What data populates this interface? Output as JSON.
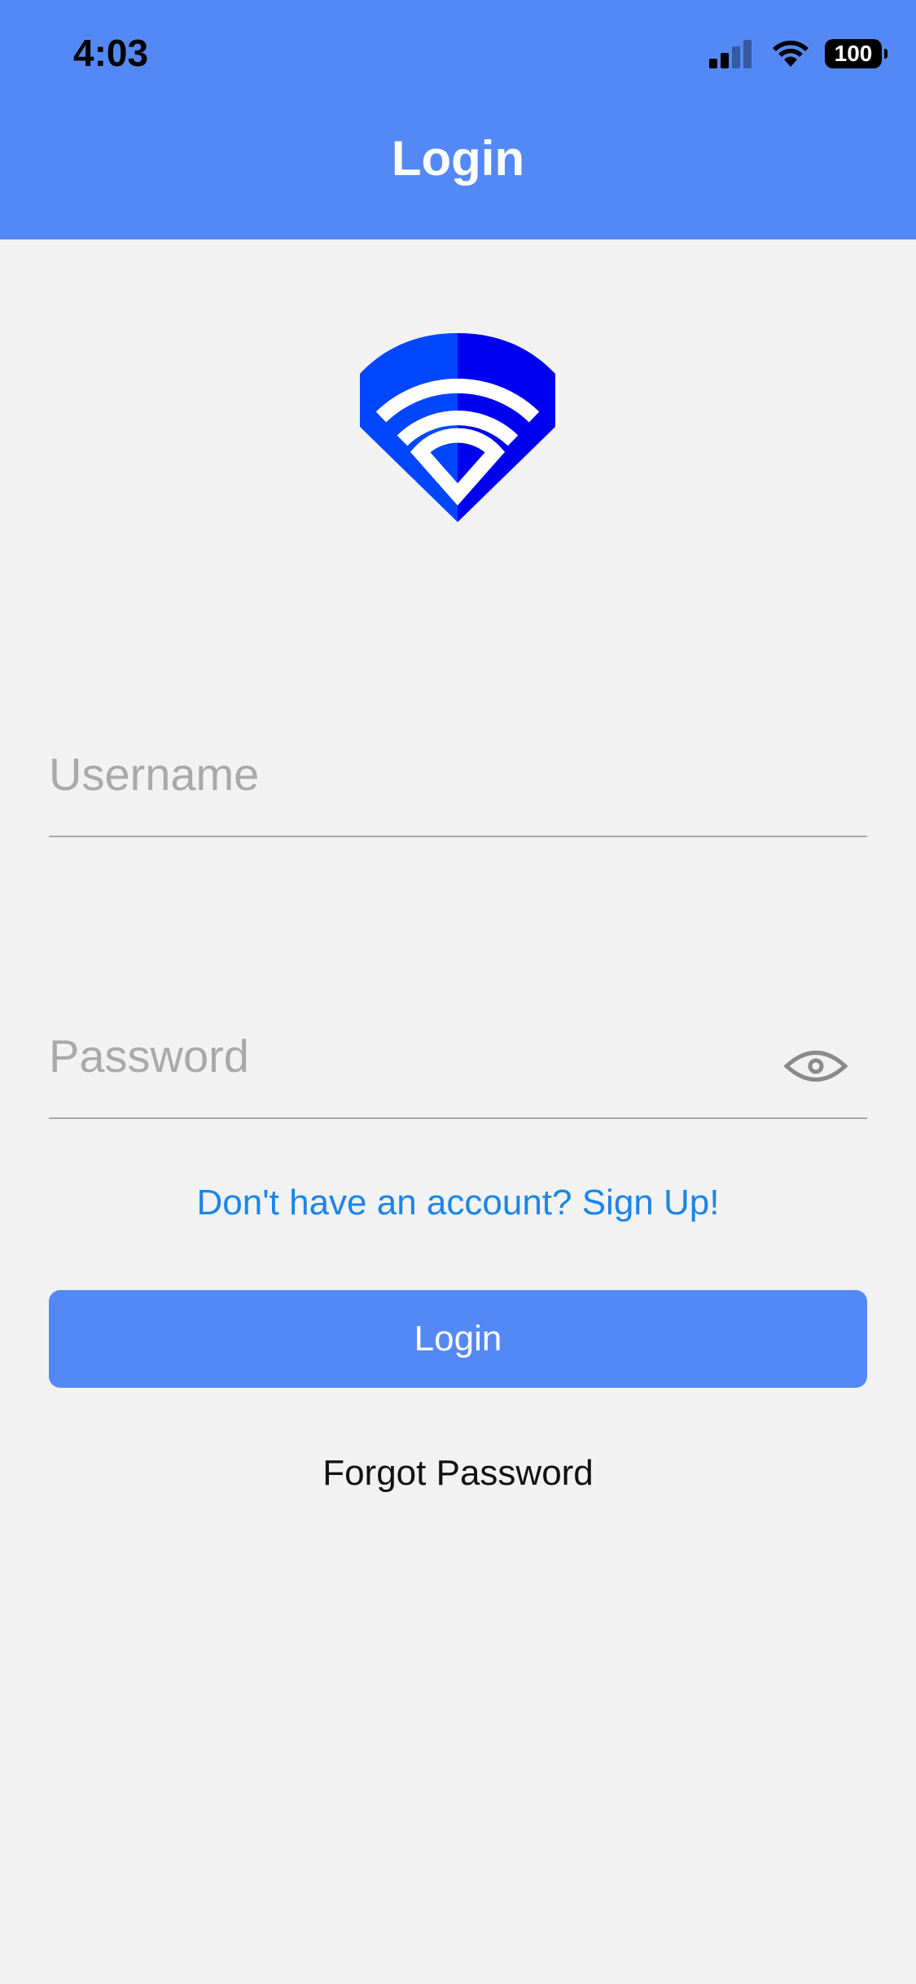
{
  "status_bar": {
    "time": "4:03",
    "battery": "100",
    "icons": [
      "signal-icon",
      "wifi-icon",
      "battery-icon"
    ]
  },
  "header": {
    "title": "Login"
  },
  "logo": {
    "icon": "wifi-shield-logo",
    "colors": [
      "#0046ff",
      "#0000f0",
      "#ffffff"
    ]
  },
  "form": {
    "username_placeholder": "Username",
    "username_value": "",
    "password_placeholder": "Password",
    "password_value": "",
    "eye_icon": "eye-icon"
  },
  "links": {
    "signup": "Don't have an account? Sign Up!",
    "forgot": "Forgot Password"
  },
  "buttons": {
    "login": "Login"
  },
  "colors": {
    "primary": "#5489f5",
    "link": "#1b85e8",
    "background": "#f2f2f2"
  }
}
